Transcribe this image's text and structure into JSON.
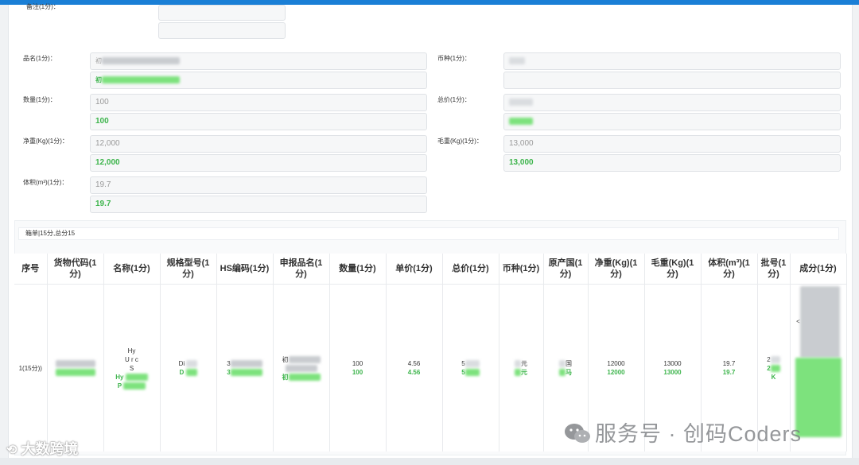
{
  "form": {
    "remark_label": "备注(1分)：",
    "name_label": "品名(1分)：",
    "name_value_prefix": "初",
    "currency_label": "币种(1分)：",
    "qty_label": "数量(1分)：",
    "qty_orig": "100",
    "qty_new": "100",
    "total_label": "总价(1分)：",
    "net_label": "净重(Kg)(1分)：",
    "net_orig": "12,000",
    "net_new": "12,000",
    "gross_label": "毛重(Kg)(1分)：",
    "gross_orig": "13,000",
    "gross_new": "13,000",
    "vol_label": "体积(m³)(1分)：",
    "vol_orig": "19.7",
    "vol_new": "19.7"
  },
  "summary": "箱单|15分,总分15",
  "table": {
    "headers": [
      "序号",
      "货物代码(1分)",
      "名称(1分)",
      "规格型号(1分)",
      "HS编码(1分)",
      "申报品名(1分)",
      "数量(1分)",
      "单价(1分)",
      "总价(1分)",
      "币种(1分)",
      "原产国(1分)",
      "净重(Kg)(1分)",
      "毛重(Kg)(1分)",
      "体积(m³)(1分)",
      "批号(1分)",
      "成分(1分)"
    ],
    "row": {
      "seq": "1(15分))",
      "name_a": "Hy",
      "name_b": "U r     c",
      "name_c": "S",
      "name_d": "Hy",
      "name_e": "P",
      "spec_a": "Di",
      "spec_b": "D",
      "hs_a": "3",
      "hs_b": "3",
      "decl_a": "初",
      "decl_b": "初",
      "qty_a": "100",
      "qty_b": "100",
      "price_a": "4.56",
      "price_b": "4.56",
      "total_a": "5",
      "total_b": "5",
      "cur_a": "元",
      "cur_b": "元",
      "origin_a": "国",
      "origin_b": "马",
      "net_a": "12000",
      "net_b": "12000",
      "gross_a": "13000",
      "gross_b": "13000",
      "vol_a": "19.7",
      "vol_b": "19.7",
      "batch_a": "2",
      "batch_b": "2",
      "batch_c": "K",
      "comp_a": "<"
    }
  },
  "watermark": {
    "wechat": "服务号 · 创码Coders",
    "brand": "大数跨境"
  },
  "colors": {
    "accent": "#1a7fd6",
    "match_green": "#3cb44b"
  }
}
